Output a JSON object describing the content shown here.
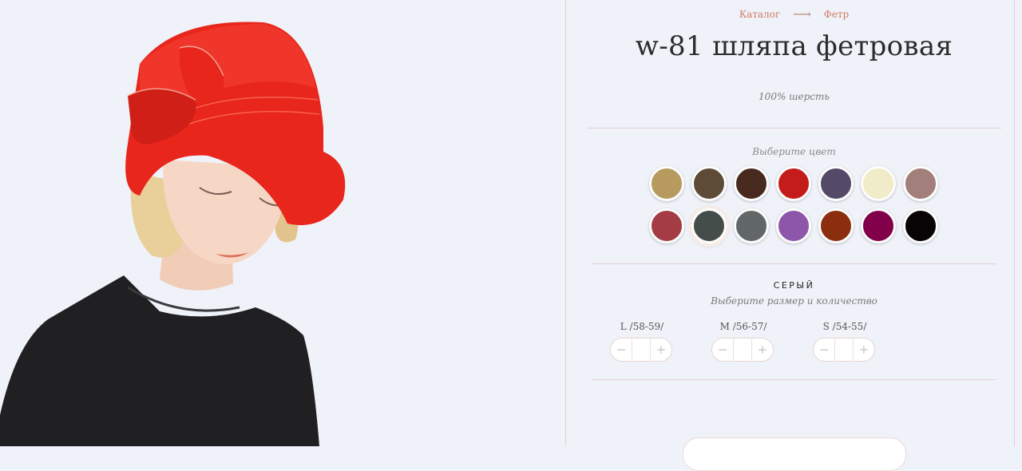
{
  "breadcrumb": {
    "catalog": "Каталог",
    "separator": "⟶",
    "current": "Фетр"
  },
  "product": {
    "title": "w-81 шляпа фетровая",
    "material": "100% шерсть"
  },
  "colors": {
    "prompt": "Выберите цвет",
    "selected_index": 8,
    "swatches": [
      "#b69a5e",
      "#5d4b37",
      "#48291e",
      "#c41c1a",
      "#544966",
      "#f0ebc8",
      "#a27f7b",
      "#a43c45",
      "#444d4a",
      "#606766",
      "#8d56aa",
      "#8b2e0e",
      "#81004a",
      "#080406"
    ]
  },
  "selection": {
    "color_name": "СЕРЫЙ",
    "size_prompt": "Выберите размер и количество",
    "sizes": [
      {
        "label": "L /58-59/"
      },
      {
        "label": "M /56-57/"
      },
      {
        "label": "S /54-55/"
      }
    ],
    "minus": "−",
    "plus": "+"
  }
}
